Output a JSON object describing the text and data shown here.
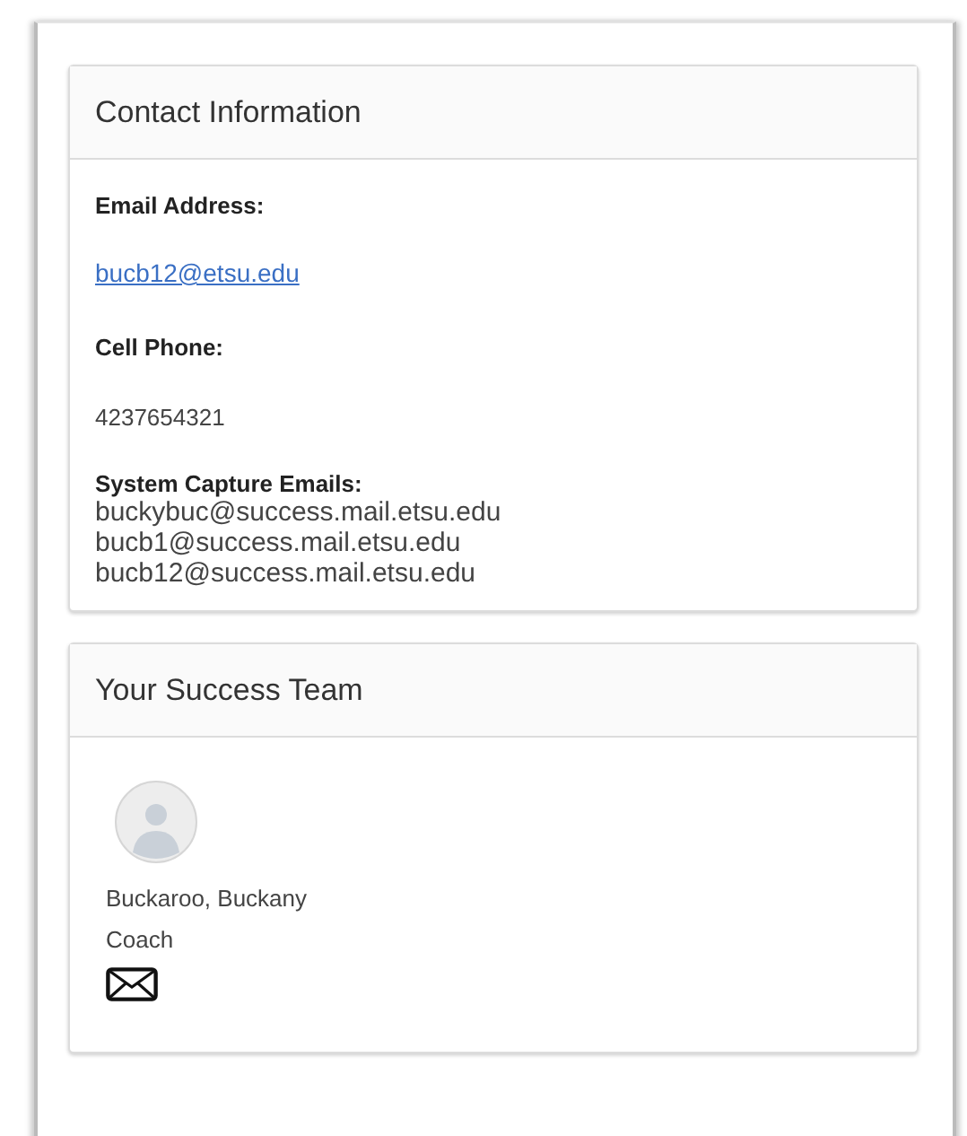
{
  "contact": {
    "title": "Contact Information",
    "email_label": "Email Address:",
    "email": "bucb12@etsu.edu",
    "phone_label": "Cell Phone:",
    "phone": "4237654321",
    "capture_label": "System Capture Emails:",
    "capture_emails": [
      "buckybuc@success.mail.etsu.edu",
      "bucb1@success.mail.etsu.edu",
      "bucb12@success.mail.etsu.edu"
    ]
  },
  "team": {
    "title": "Your Success Team",
    "members": [
      {
        "name": "Buckaroo, Buckany",
        "role": "Coach"
      }
    ]
  }
}
